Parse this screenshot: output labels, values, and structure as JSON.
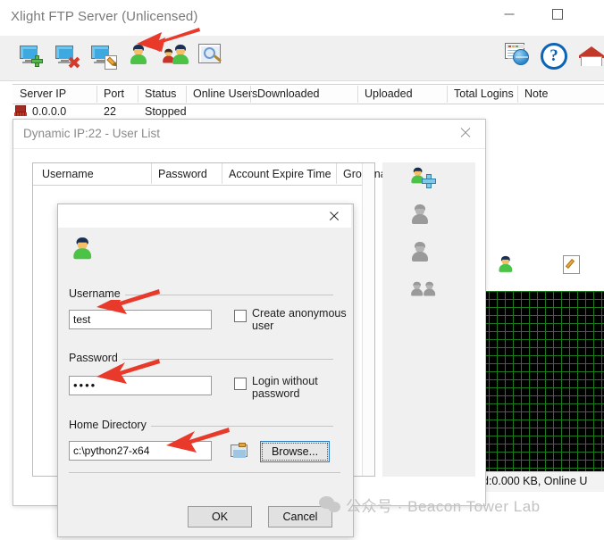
{
  "window": {
    "title": "Xlight FTP Server (Unlicensed)",
    "minimize_label": "Minimize",
    "maximize_label": "Maximize"
  },
  "toolbar": {
    "icons": [
      {
        "name": "add-server-icon",
        "label": "Add Virtual Server"
      },
      {
        "name": "remove-server-icon",
        "label": "Remove Virtual Server"
      },
      {
        "name": "edit-server-icon",
        "label": "Edit Virtual Server"
      },
      {
        "name": "user-icon",
        "label": "User List"
      },
      {
        "name": "group-icon",
        "label": "Group List"
      },
      {
        "name": "monitor-icon",
        "label": "Monitor"
      }
    ],
    "right_icons": [
      {
        "name": "web-console-icon",
        "label": "Web Admin"
      },
      {
        "name": "help-icon",
        "label": "Help"
      },
      {
        "name": "home-icon",
        "label": "Home"
      }
    ],
    "help_glyph": "?"
  },
  "server_list": {
    "columns": [
      "Server IP",
      "Port",
      "Status",
      "Online Users",
      "Downloaded",
      "Uploaded",
      "Total Logins",
      "Note"
    ],
    "rows": [
      {
        "server_ip": "0.0.0.0",
        "port": "22",
        "status": "Stopped",
        "online_users": "",
        "downloaded": "",
        "uploaded": "",
        "total_logins": "",
        "note": ""
      }
    ]
  },
  "user_list_window": {
    "title": "Dynamic IP:22 - User List",
    "close_label": "Close",
    "columns": [
      "Username",
      "Password",
      "Account Expire Time",
      "Groupname"
    ],
    "rows": [],
    "side_buttons": [
      {
        "name": "add-user-button",
        "label": "Add User"
      },
      {
        "name": "edit-user-button",
        "label": "Edit User"
      },
      {
        "name": "delete-user-button",
        "label": "Delete User"
      },
      {
        "name": "copy-user-button",
        "label": "Copy User"
      }
    ]
  },
  "add_user_dialog": {
    "close_label": "Close",
    "avatar_name": "user-avatar-icon",
    "username": {
      "group_label": "Username",
      "value": "test",
      "placeholder": ""
    },
    "anonymous": {
      "label": "Create anonymous user",
      "checked": false
    },
    "password": {
      "group_label": "Password",
      "value": "••••",
      "placeholder": ""
    },
    "login_without_password": {
      "label": "Login without password",
      "checked": false
    },
    "home_directory": {
      "group_label": "Home Directory",
      "value": "c:\\python27-x64",
      "placeholder": "",
      "browse_label": "Browse...",
      "folder_icon": "folder-icon"
    },
    "buttons": {
      "ok": "OK",
      "cancel": "Cancel"
    }
  },
  "status_bar": {
    "text": "d:0.000 KB, Online U"
  },
  "watermark": {
    "text": "公众号 · Beacon Tower Lab",
    "logo_name": "wechat-logo-icon"
  },
  "annotations": {
    "arrow_color": "#e8392a",
    "arrows": [
      {
        "name": "arrow-to-user-toolbar-icon"
      },
      {
        "name": "arrow-to-username-field"
      },
      {
        "name": "arrow-to-password-field"
      },
      {
        "name": "arrow-to-home-directory-field"
      }
    ]
  },
  "colors": {
    "accent": "#0d63b5",
    "grid_green": "#1e7a1e",
    "toolbar_bg": "#f0f0f0",
    "dialog_bg": "#f0f0f0"
  }
}
